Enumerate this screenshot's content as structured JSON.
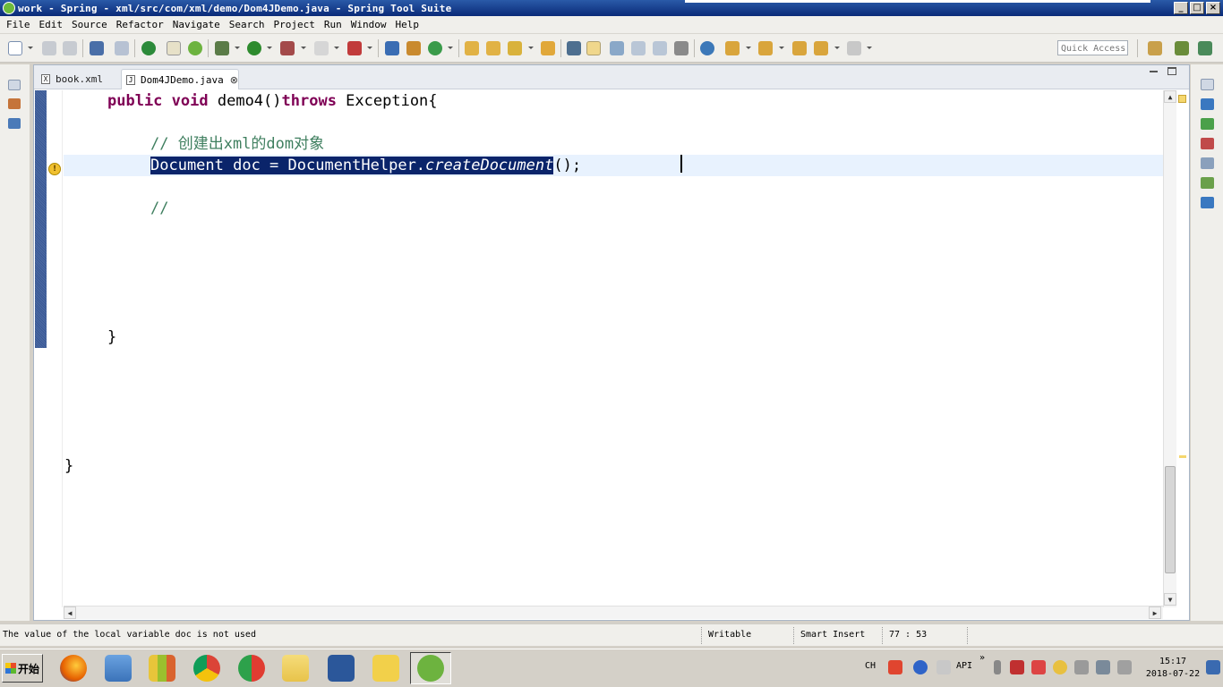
{
  "window": {
    "title": "work - Spring - xml/src/com/xml/demo/Dom4JDemo.java - Spring Tool Suite",
    "btn_min": "_",
    "btn_max": "□",
    "btn_close": "×"
  },
  "menu": [
    "File",
    "Edit",
    "Source",
    "Refactor",
    "Navigate",
    "Search",
    "Project",
    "Run",
    "Window",
    "Help"
  ],
  "toolbar": {
    "quick_access_placeholder": "Quick Access"
  },
  "tabs": [
    {
      "label": "book.xml",
      "icon_label": "X",
      "icon": "xml-file-icon"
    },
    {
      "label": "Dom4JDemo.java",
      "icon_label": "J",
      "icon": "java-file-icon",
      "close": "⊗"
    }
  ],
  "code": {
    "line1": {
      "kw1": "public",
      "kw2": "void",
      "text": " demo4()",
      "kw3": "throws",
      "text2": " Exception{"
    },
    "comment": "// 创建出xml的dom对象",
    "line3_selected": "Document doc = DocumentHelper.",
    "line3_method": "createDocument",
    "line3_rest": "();",
    "comment2": "//",
    "close_brace_inner": "}",
    "close_brace_outer": "}"
  },
  "status": {
    "message": "The value of the local variable doc is not used",
    "writable": "Writable",
    "insert_mode": "Smart Insert",
    "position": "77 : 53"
  },
  "taskbar": {
    "start_label": "开始",
    "apps": [
      {
        "name": "firefox",
        "color": "#e66000"
      },
      {
        "name": "virtual-machine",
        "color": "#3b73b9"
      },
      {
        "name": "pencils",
        "color": "#9bbf2e"
      },
      {
        "name": "chrome",
        "color": "#db4437"
      },
      {
        "name": "xmind",
        "color": "#2da14b"
      },
      {
        "name": "folder",
        "color": "#e8c34a"
      },
      {
        "name": "word",
        "color": "#2b579a"
      },
      {
        "name": "help",
        "color": "#f2d04a"
      },
      {
        "name": "spring-tool-suite",
        "color": "#6db33f"
      }
    ],
    "ime": "CH",
    "api": "API",
    "overflow": "»",
    "clock_time": "15:17",
    "clock_date": "2018-07-22"
  },
  "colors": {
    "keyword": "#7f0055",
    "comment": "#3f7f5f",
    "selection": "#0a246a",
    "current_line": "#e8f2fe"
  }
}
